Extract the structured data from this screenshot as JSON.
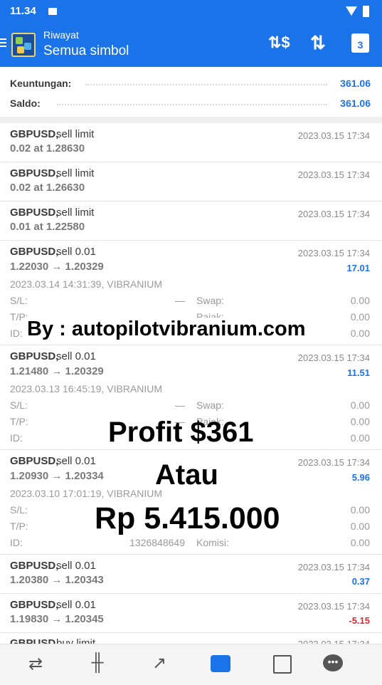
{
  "status_bar": {
    "time": "11.34"
  },
  "app_bar": {
    "subtitle": "Riwayat",
    "title": "Semua simbol",
    "calendar_day": "3"
  },
  "summary": {
    "profit_label": "Keuntungan:",
    "profit_value": "361.06",
    "balance_label": "Saldo:",
    "balance_value": "361.06"
  },
  "orders": [
    {
      "symbol": "GBPUSD,",
      "type": "sell limit",
      "detail": "0.02 at 1.28630",
      "time": "2023.03.15 17:34"
    },
    {
      "symbol": "GBPUSD,",
      "type": "sell limit",
      "detail": "0.02 at 1.26630",
      "time": "2023.03.15 17:34"
    },
    {
      "symbol": "GBPUSD,",
      "type": "sell limit",
      "detail": "0.01 at 1.22580",
      "time": "2023.03.15 17:34"
    }
  ],
  "deals": [
    {
      "symbol": "GBPUSD,",
      "type": "sell 0.01",
      "prices": "1.22030 → 1.20329",
      "time": "2023.03.15 17:34",
      "profit": "17.01",
      "open_line": "2023.03.14 14:31:39, VIBRANIUM",
      "sl_label": "S/L:",
      "sl": "—",
      "swap_label": "Swap:",
      "swap": "0.00",
      "tp_label": "T/P:",
      "tp": "—",
      "tax_label": "Pajak:",
      "tax": "0.00",
      "id_label": "ID:",
      "id": "",
      "comm_label": "Komisi:",
      "comm": "0.00"
    },
    {
      "symbol": "GBPUSD,",
      "type": "sell 0.01",
      "prices": "1.21480 → 1.20329",
      "time": "2023.03.15 17:34",
      "profit": "11.51",
      "open_line": "2023.03.13 16:45:19, VIBRANIUM",
      "sl_label": "S/L:",
      "sl": "—",
      "swap_label": "Swap:",
      "swap": "0.00",
      "tp_label": "T/P:",
      "tp": "—",
      "tax_label": "Pajak:",
      "tax": "0.00",
      "id_label": "ID:",
      "id": "",
      "comm_label": "Komisi:",
      "comm": "0.00"
    },
    {
      "symbol": "GBPUSD,",
      "type": "sell 0.01",
      "prices": "1.20930 → 1.20334",
      "time": "2023.03.15 17:34",
      "profit": "5.96",
      "open_line": "2023.03.10 17:01:19, VIBRANIUM",
      "sl_label": "S/L:",
      "sl": "",
      "swap_label": "",
      "swap": "0.00",
      "tp_label": "T/P:",
      "tp": "",
      "tax_label": "",
      "tax": "0.00",
      "id_label": "ID:",
      "id": "1326848649",
      "comm_label": "Komisi:",
      "comm": "0.00"
    }
  ],
  "closed": [
    {
      "symbol": "GBPUSD,",
      "type": "sell 0.01",
      "prices": "1.20380 → 1.20343",
      "time": "2023.03.15 17:34",
      "profit": "0.37"
    },
    {
      "symbol": "GBPUSD,",
      "type": "sell 0.01",
      "prices": "1.19830 → 1.20345",
      "time": "2023.03.15 17:34",
      "profit": "-5.15"
    },
    {
      "symbol": "GBPUSD,",
      "type": "buy limit",
      "time": "2023.03.15 17:34"
    }
  ],
  "overlay": {
    "by": "By : autopilotvibranium.com",
    "profit": "Profit $361",
    "or": "Atau",
    "rupiah": "Rp 5.415.000"
  },
  "colors": {
    "primary": "#1a73e8",
    "sell": "#d32f2f",
    "loss": "#d32f2f",
    "gain": "#1a73e8"
  }
}
